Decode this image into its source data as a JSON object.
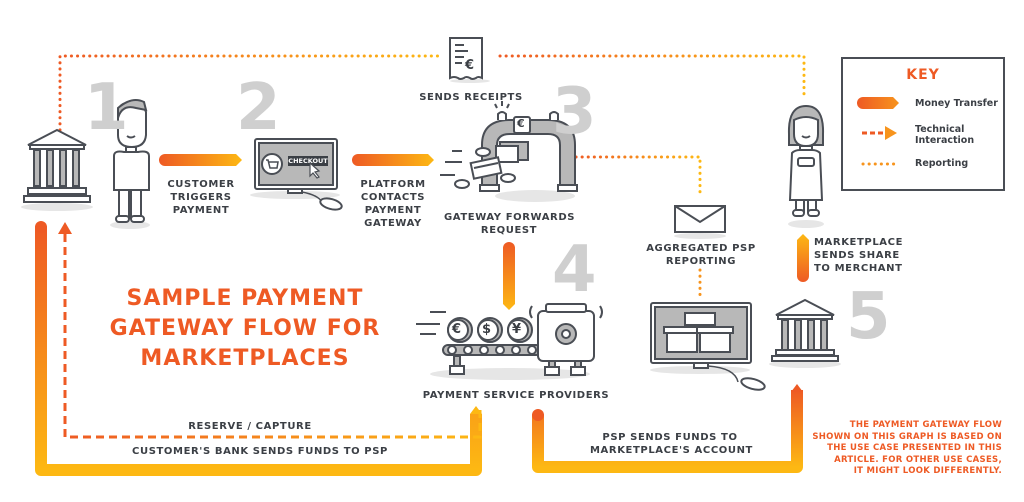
{
  "title": {
    "line1": "SAMPLE PAYMENT",
    "line2": "GATEWAY FLOW FOR",
    "line3": "MARKETPLACES"
  },
  "colors": {
    "orange_dark": "#ee5a24",
    "orange_light": "#fdb813",
    "text_dark": "#3b3f45",
    "step_gray": "#cfcfcf",
    "icon_stroke": "#4a4e55",
    "icon_fill": "#b8b8b8"
  },
  "key": {
    "title": "KEY",
    "items": [
      {
        "type": "money-transfer",
        "label": "Money Transfer"
      },
      {
        "type": "technical-interaction",
        "label_line1": "Technical",
        "label_line2": "Interaction"
      },
      {
        "type": "reporting",
        "label": "Reporting"
      }
    ]
  },
  "steps": [
    {
      "number": "1",
      "actor": "customer"
    },
    {
      "number": "2",
      "actor": "platform"
    },
    {
      "number": "3",
      "actor": "payment-gateway"
    },
    {
      "number": "4",
      "actor": "payment-service-providers"
    },
    {
      "number": "5",
      "actor": "marketplace-bank"
    }
  ],
  "labels": {
    "customer_triggers": [
      "CUSTOMER",
      "TRIGGERS",
      "PAYMENT"
    ],
    "platform_contacts": [
      "PLATFORM",
      "CONTACTS",
      "PAYMENT",
      "GATEWAY"
    ],
    "gateway_forwards": [
      "GATEWAY FORWARDS",
      "REQUEST"
    ],
    "sends_receipts": "SENDS RECEIPTS",
    "aggregated_psp": [
      "AGGREGATED PSP",
      "REPORTING"
    ],
    "marketplace_sends": [
      "MARKETPLACE",
      "SENDS SHARE",
      "TO MERCHANT"
    ],
    "psp": "PAYMENT SERVICE PROVIDERS",
    "reserve_capture": "RESERVE / CAPTURE",
    "customers_bank": "CUSTOMER'S BANK SENDS FUNDS TO PSP",
    "psp_sends_funds": [
      "PSP SENDS FUNDS TO",
      "MARKETPLACE'S ACCOUNT"
    ],
    "checkout_button": "CHECKOUT"
  },
  "note": [
    "THE PAYMENT GATEWAY FLOW",
    "SHOWN ON THIS GRAPH IS BASED ON",
    "THE USE CASE PRESENTED IN THIS",
    "ARTICLE. FOR OTHER USE CASES,",
    "IT MIGHT LOOK DIFFERENTLY."
  ],
  "icons": {
    "receipt_currency": "€",
    "coins": [
      "€",
      "$",
      "¥"
    ],
    "gateway_currency": "€"
  }
}
